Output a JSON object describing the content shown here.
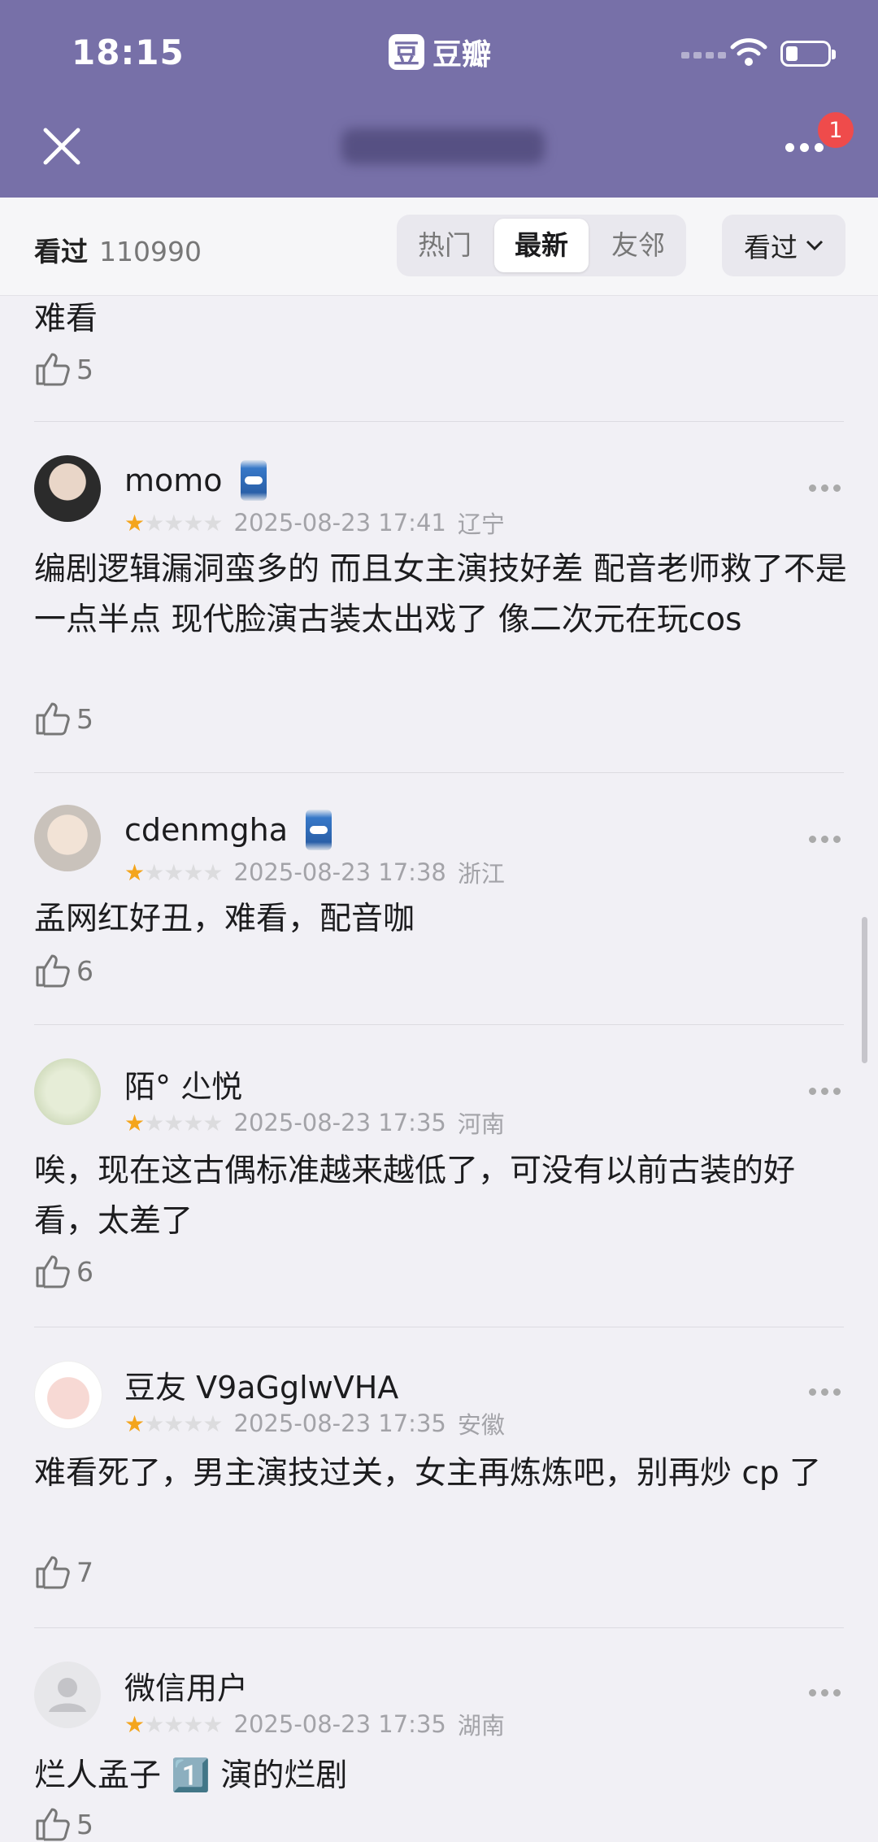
{
  "status": {
    "time": "18:15",
    "brand_glyph": "豆",
    "brand_name": "豆瓣"
  },
  "header": {
    "notification_count": "1"
  },
  "filter": {
    "watched_label": "看过",
    "watched_count": "110990",
    "tabs": [
      "热门",
      "最新",
      "友邻"
    ],
    "active_tab": "最新",
    "dropdown_label": "看过"
  },
  "partial_review": {
    "text": "难看",
    "likes": "5"
  },
  "reviews": [
    {
      "name": "momo",
      "rating": 1,
      "date": "2025-08-23 17:41",
      "location": "辽宁",
      "text": "编剧逻辑漏洞蛮多的 而且女主演技好差 配音老师救了不是一点半点  现代脸演古装太出戏了 像二次元在玩cos",
      "likes": "5"
    },
    {
      "name": "cdenmgha",
      "rating": 1,
      "date": "2025-08-23 17:38",
      "location": "浙江",
      "text": "孟网红好丑，难看，配音咖",
      "likes": "6"
    },
    {
      "name": "陌° 尐悦",
      "rating": 1,
      "date": "2025-08-23 17:35",
      "location": "河南",
      "text": "唉，现在这古偶标准越来越低了，可没有以前古装的好看，太差了",
      "likes": "6"
    },
    {
      "name": "豆友 V9aGglwVHA",
      "rating": 1,
      "date": "2025-08-23 17:35",
      "location": "安徽",
      "text": "难看死了，男主演技过关，女主再炼炼吧，别再炒 cp 了",
      "likes": "7"
    },
    {
      "name": "微信用户",
      "rating": 1,
      "date": "2025-08-23 17:35",
      "location": "湖南",
      "text": "烂人孟子 1️⃣ 演的烂剧",
      "likes": "5"
    }
  ],
  "colors": {
    "header_bg": "#7770a8",
    "star_on": "#f4a51c",
    "badge": "#ef4b4b"
  }
}
